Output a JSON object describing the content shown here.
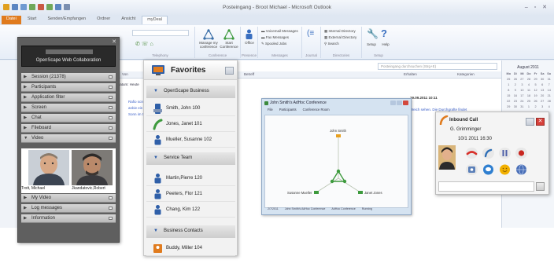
{
  "outlook": {
    "window_title": "Posteingang - Broot Michael - Microsoft Outlook",
    "tabs": [
      "Datei",
      "Start",
      "Senden/Empfangen",
      "Ordner",
      "Ansicht",
      "myDeal"
    ],
    "ribbon": {
      "groups": [
        "Telephony",
        "Conference",
        "Presence",
        "Messages",
        "Journal",
        "Directories",
        "Setup"
      ],
      "buttons": {
        "manage": "Manage my conference",
        "start": "Start Conference",
        "office": "Office",
        "voicemail": "Voicemail Messages",
        "fax": "Fax Messages",
        "spooled": "Spooled Jobs",
        "internal": "Internal Directory",
        "external": "External Directory",
        "search": "Search",
        "setup": "Setup",
        "help": "Help"
      }
    },
    "search_placeholder": "Posteingang durchsuchen (Strg+E)",
    "columns": [
      "Von",
      "Betreff",
      "Erhalten",
      "Kategorien"
    ],
    "mail": {
      "group_today": "Datum: Heute",
      "sender_1": "Rafio screm",
      "sender_2": "anbie ein S",
      "sender_3": "Sonn im 07",
      "date": "19.09.2011 10:11",
      "snippet": "Weich sehen. Die Durchgrafte findet"
    },
    "calendar": {
      "title": "August 2011",
      "weekdays": [
        "Mo",
        "Di",
        "Mi",
        "Do",
        "Fr",
        "Sa",
        "So"
      ],
      "days": [
        "25",
        "26",
        "27",
        "28",
        "29",
        "30",
        "31",
        "1",
        "2",
        "3",
        "4",
        "5",
        "6",
        "7",
        "8",
        "9",
        "10",
        "11",
        "12",
        "13",
        "14",
        "15",
        "16",
        "17",
        "18",
        "19",
        "20",
        "21",
        "22",
        "23",
        "24",
        "25",
        "26",
        "27",
        "28",
        "29",
        "30",
        "31",
        "1",
        "2",
        "3",
        "4"
      ]
    }
  },
  "owc": {
    "title": "OpenScape Web Collaboration",
    "sections": [
      {
        "label": "Session (21378)",
        "arrow": "▶"
      },
      {
        "label": "Participants",
        "arrow": "▶"
      },
      {
        "label": "Application filter",
        "arrow": "▶"
      },
      {
        "label": "Screen",
        "arrow": "▶"
      },
      {
        "label": "Chat",
        "arrow": "▶"
      },
      {
        "label": "Fileboard",
        "arrow": "▶"
      },
      {
        "label": "Video",
        "arrow": "▼"
      },
      {
        "label": "My Video",
        "arrow": "▶"
      },
      {
        "label": "Log messages",
        "arrow": "▶"
      },
      {
        "label": "Information",
        "arrow": "▶"
      }
    ],
    "video_names": [
      "Trott, Michael",
      "Jkandatovic,Robert"
    ]
  },
  "favorites": {
    "title": "Favorites",
    "groups": [
      "OpenScape Business",
      "Service Team",
      "Business Contacts"
    ],
    "items": [
      "Smith, John  100",
      "Jones, Janet  101",
      "Mueller, Susanne  102",
      "Martin,Pierre  120",
      "Peeters, Flor  121",
      "Chang, Kim  122",
      "Buddy, Miller  104"
    ]
  },
  "conference": {
    "title": "John Smith's AdHoc Conference",
    "menu": [
      "File",
      "Participants",
      "Conference Room"
    ],
    "nodes": [
      "John Smith",
      "Susanne Mueller",
      "Janet Jones"
    ],
    "status": [
      "2/7/2011",
      "John Smith's AdHoc Conference",
      "AdHoc Conference",
      "Running"
    ]
  },
  "call": {
    "title": "Inbound Call",
    "caller": "G. Grimminger",
    "time": "10/1 2011 16:30",
    "colors": {
      "hangup": "#d8302a",
      "transfer": "#2f6fb7",
      "hold": "#4c5ea8",
      "record": "#c8261f",
      "chat": "#2f7fd0",
      "smiley": "#f2b000",
      "web": "#4a6fb8"
    }
  }
}
